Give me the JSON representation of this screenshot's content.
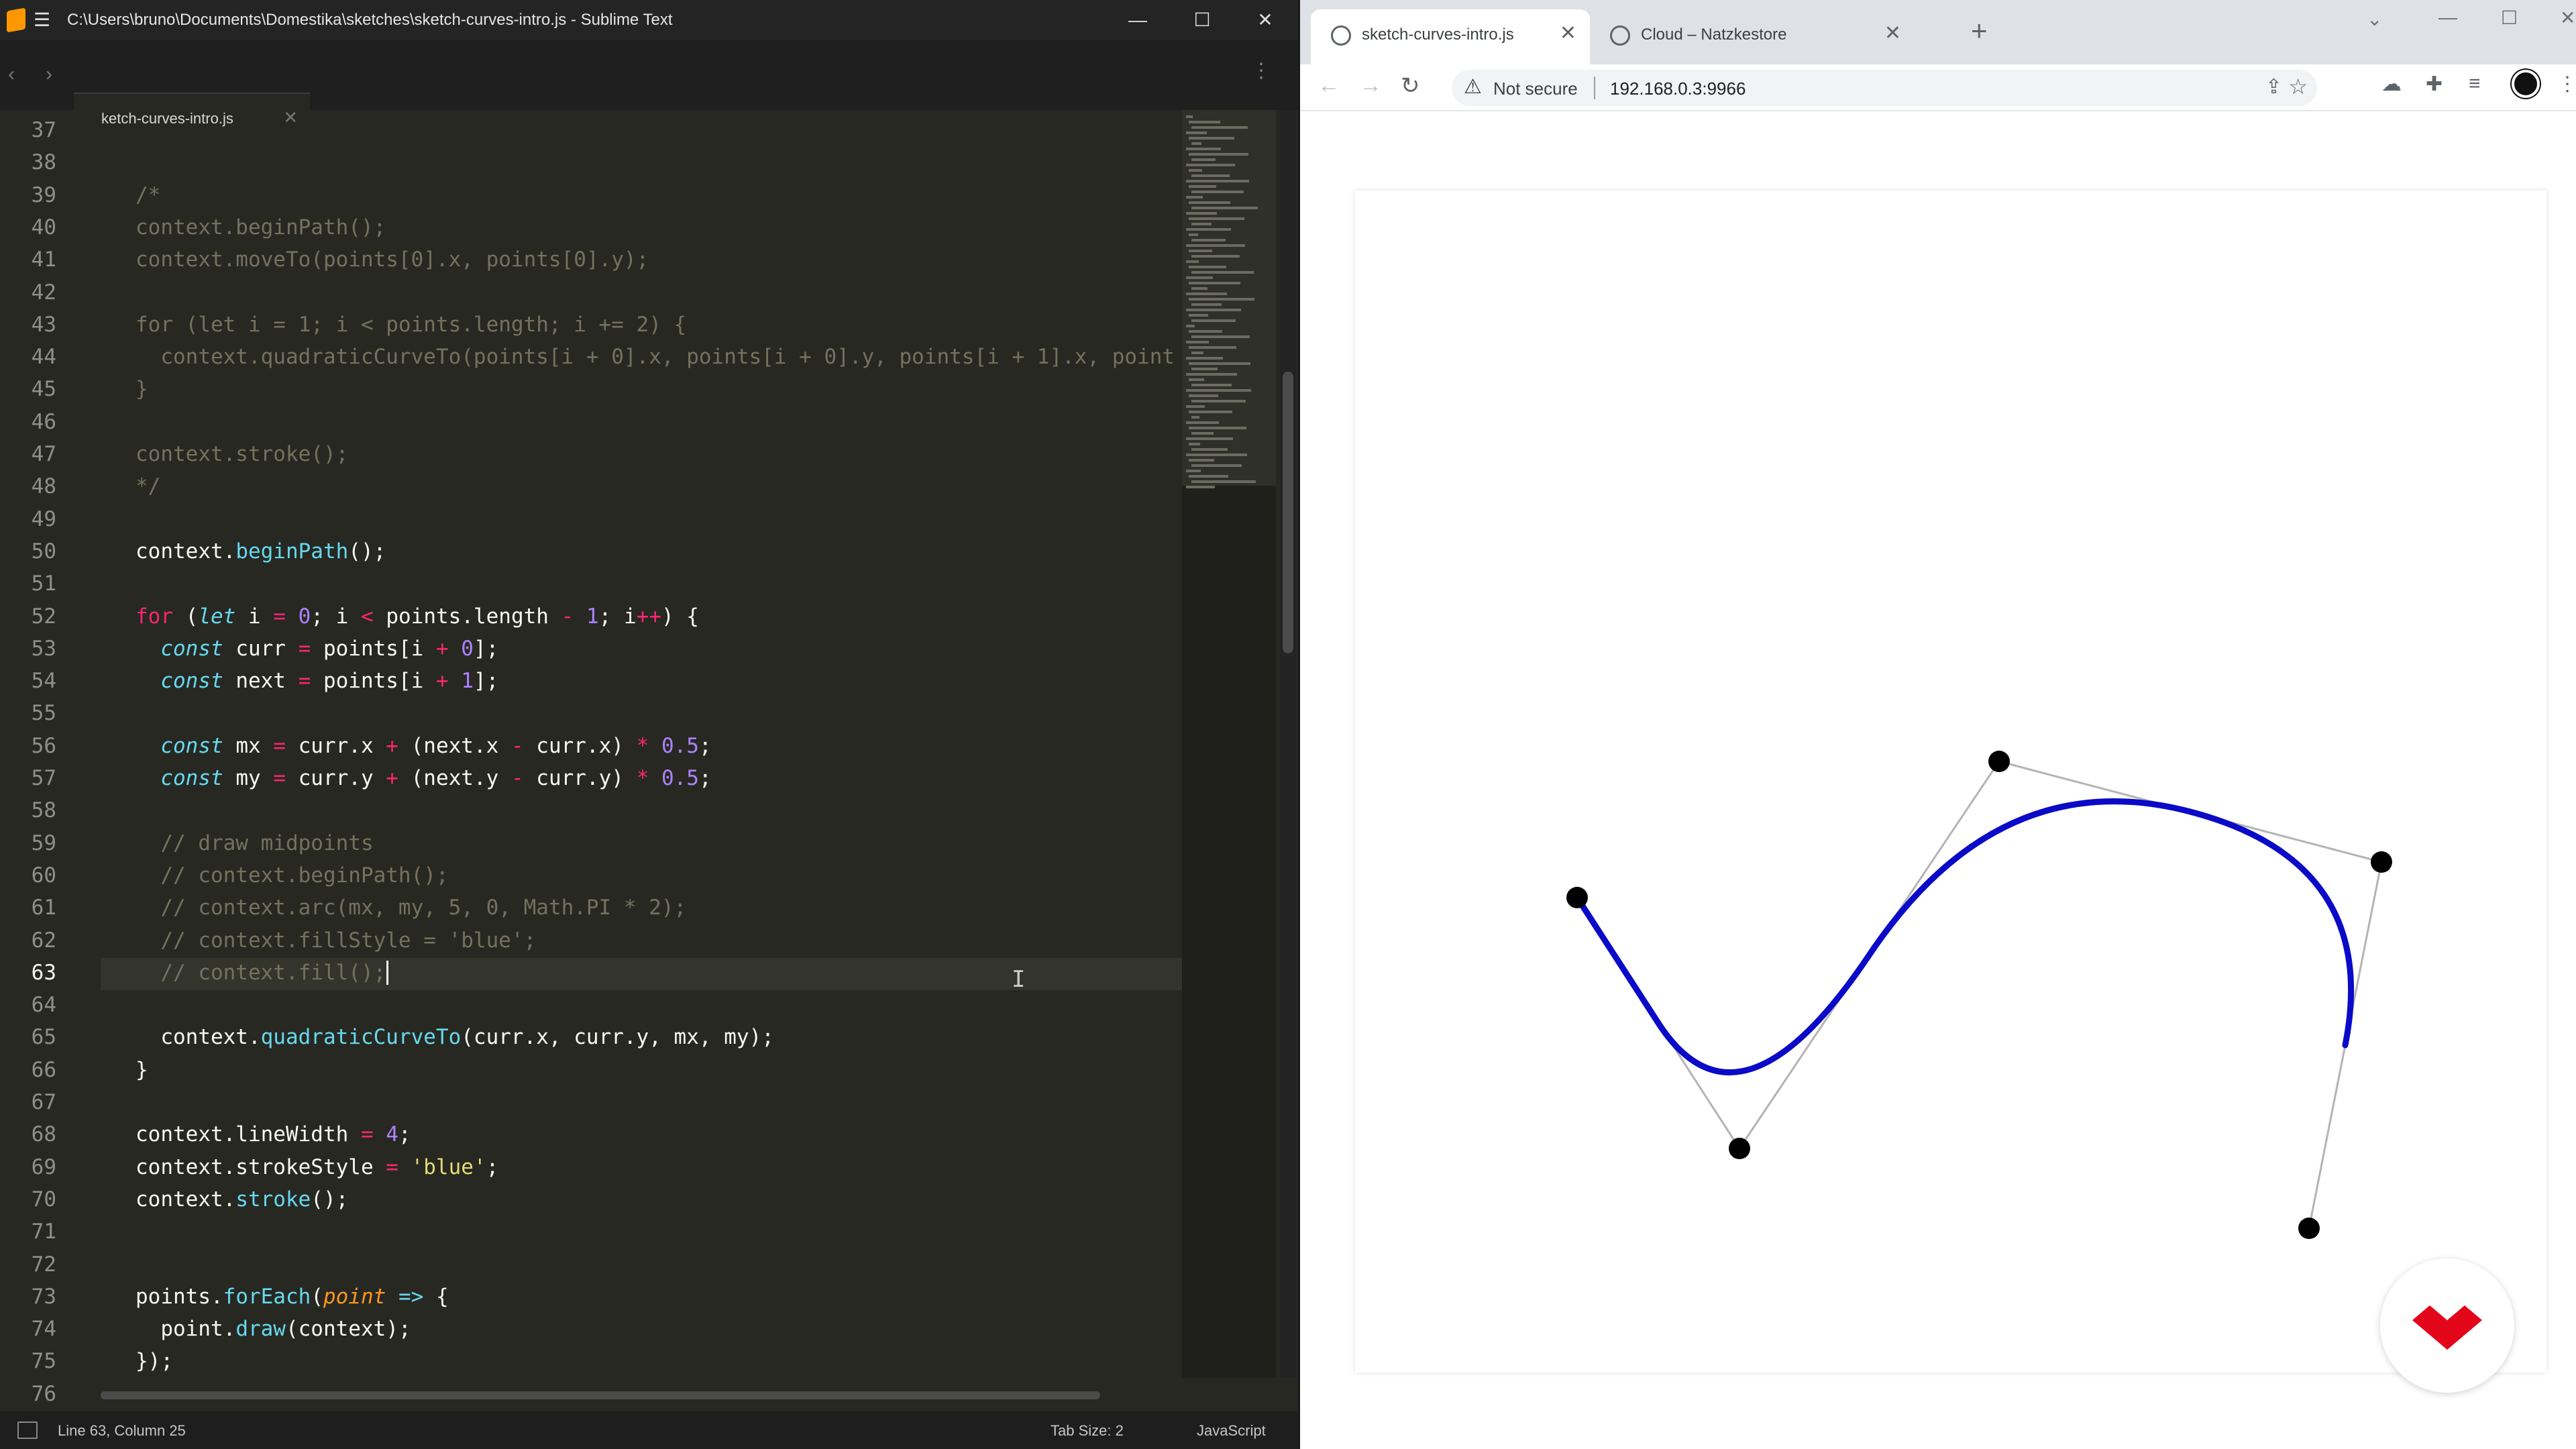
{
  "sublime": {
    "title": "C:\\Users\\bruno\\Documents\\Domestika\\sketches\\sketch-curves-intro.js - Sublime Text",
    "tab_label": "sketch-curves-intro.js",
    "status_left": "Line 63, Column 25",
    "status_tab": "Tab Size: 2",
    "status_lang": "JavaScript",
    "line_numbers": [
      "37",
      "38",
      "39",
      "40",
      "41",
      "42",
      "43",
      "44",
      "45",
      "46",
      "47",
      "48",
      "49",
      "50",
      "51",
      "52",
      "53",
      "54",
      "55",
      "56",
      "57",
      "58",
      "59",
      "60",
      "61",
      "62",
      "63",
      "64",
      "65",
      "66",
      "67",
      "68",
      "69",
      "70",
      "71",
      "72",
      "73",
      "74",
      "75",
      "76"
    ],
    "current_line": "63",
    "code": [
      "",
      "",
      "/*",
      "context.beginPath();",
      "context.moveTo(points[0].x, points[0].y);",
      "",
      "for (let i = 1; i < points.length; i += 2) {",
      "  context.quadraticCurveTo(points[i + 0].x, points[i + 0].y, points[i + 1].x, point",
      "}",
      "",
      "context.stroke();",
      "*/",
      "",
      "context.beginPath();",
      "",
      "for (let i = 0; i < points.length - 1; i++) {",
      "  const curr = points[i + 0];",
      "  const next = points[i + 1];",
      "",
      "  const mx = curr.x + (next.x - curr.x) * 0.5;",
      "  const my = curr.y + (next.y - curr.y) * 0.5;",
      "",
      "  // draw midpoints",
      "  // context.beginPath();",
      "  // context.arc(mx, my, 5, 0, Math.PI * 2);",
      "  // context.fillStyle = 'blue';",
      "  // context.fill();",
      "",
      "  context.quadraticCurveTo(curr.x, curr.y, mx, my);",
      "}",
      "",
      "context.lineWidth = 4;",
      "context.strokeStyle = 'blue';",
      "context.stroke();",
      "",
      "",
      "points.forEach(point => {",
      "  point.draw(context);",
      "});",
      "};"
    ]
  },
  "chrome": {
    "tabs": [
      {
        "label": "sketch-curves-intro.js"
      },
      {
        "label": "Cloud – Natzkestore"
      }
    ],
    "not_secure": "Not secure",
    "url": "192.168.0.3:9966"
  },
  "sketch": {
    "curve_color": "#0a0ac8",
    "point_color": "#000000",
    "guide_color": "#b4b4b4"
  }
}
